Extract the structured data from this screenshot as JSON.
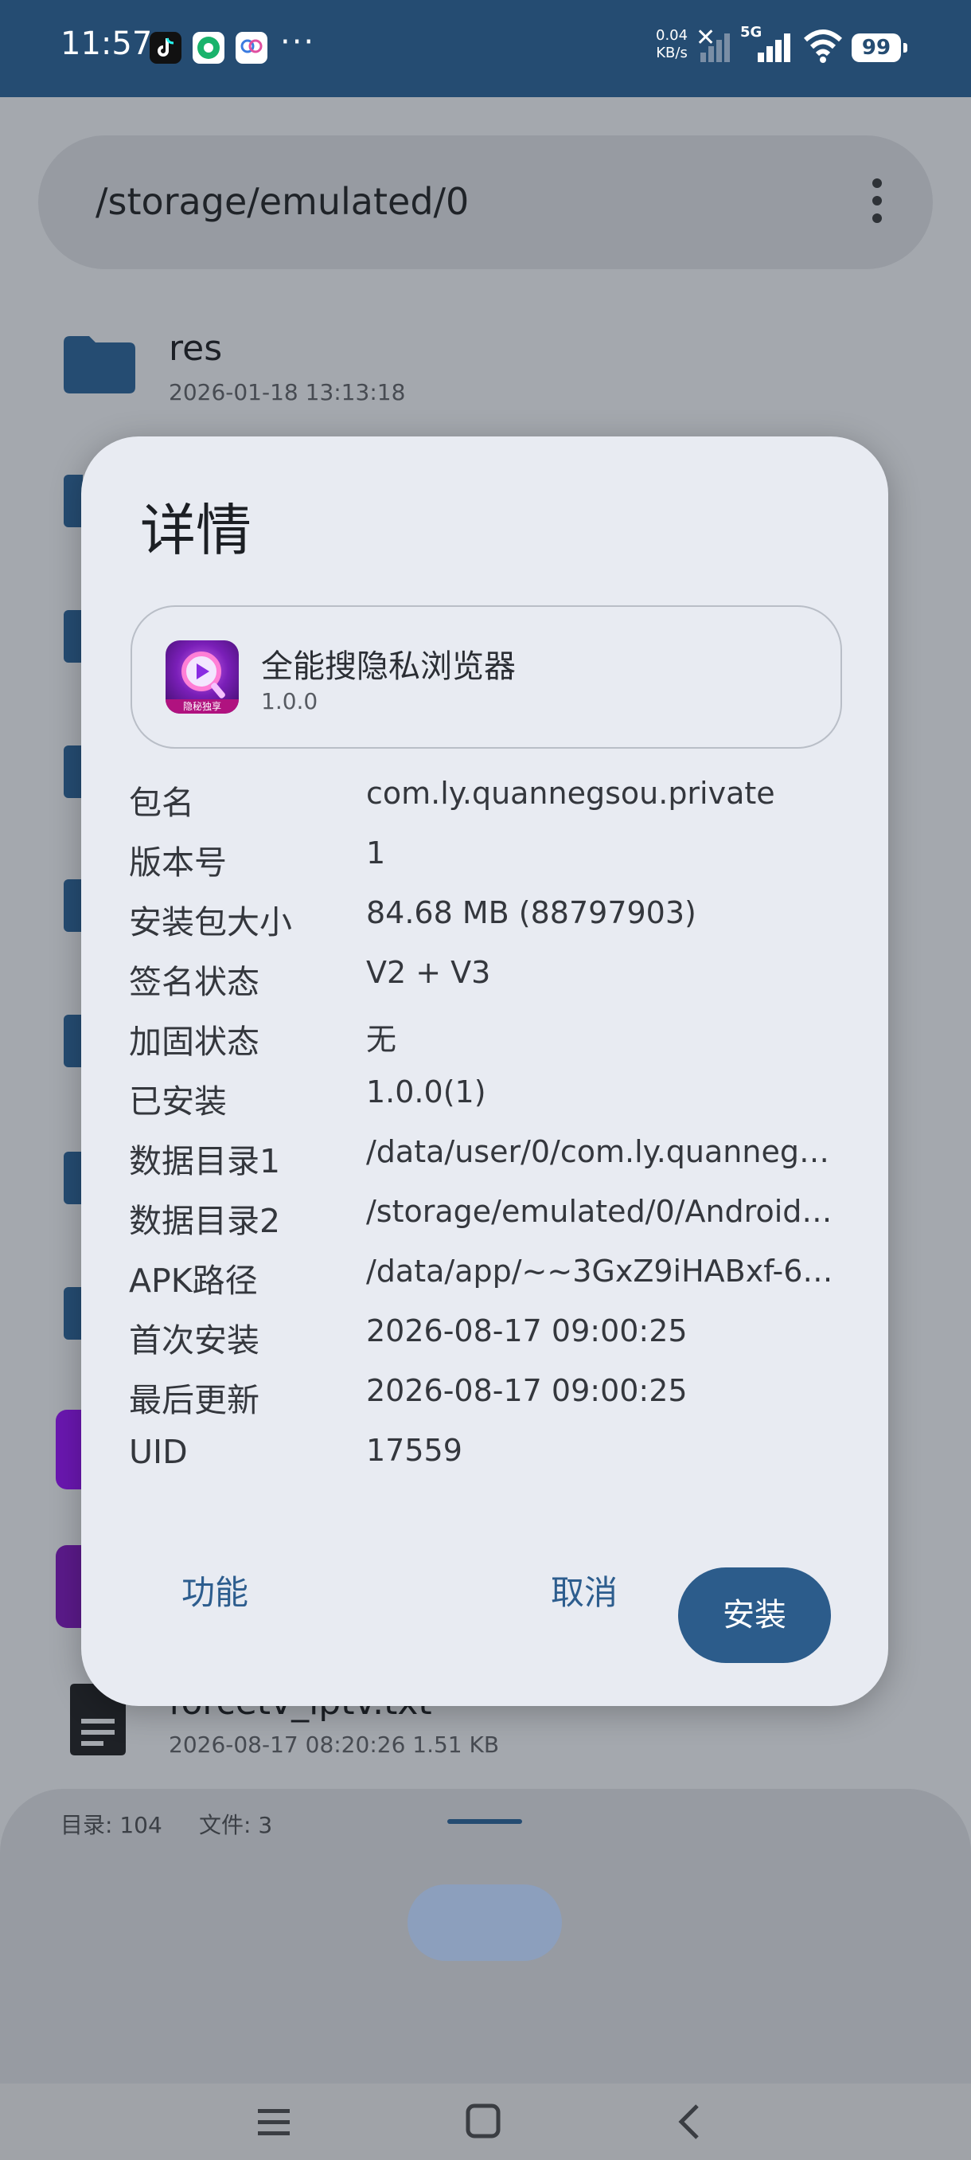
{
  "status_bar": {
    "time": "11:57",
    "net_speed_value": "0.04",
    "net_speed_unit": "KB/s",
    "network_type": "5G",
    "battery": "99",
    "overflow": "···",
    "notification_icons": [
      "tiktok-icon",
      "app-green-icon",
      "app-blue-icon"
    ]
  },
  "path_bar": {
    "path": "/storage/emulated/0"
  },
  "file_list": {
    "items": [
      {
        "name": "res",
        "meta": "2026-01-18 13:13:18",
        "icon": "folder-icon"
      },
      {
        "name": "forcetv_iptv.txt",
        "meta": "2026-08-17 08:20:26   1.51 KB",
        "icon": "text-file-icon"
      }
    ]
  },
  "footer": {
    "dir_count": "目录: 104",
    "file_count": "文件: 3"
  },
  "dialog": {
    "title": "详情",
    "app": {
      "name": "全能搜隐私浏览器",
      "version": "1.0.0",
      "icon_badge": "隐秘独享"
    },
    "rows": [
      {
        "label": "包名",
        "value": "com.ly.quannegsou.private"
      },
      {
        "label": "版本号",
        "value": "1"
      },
      {
        "label": "安装包大小",
        "value": "84.68 MB (88797903)"
      },
      {
        "label": "签名状态",
        "value": "V2 + V3"
      },
      {
        "label": "加固状态",
        "value": "无"
      },
      {
        "label": "已安装",
        "value": "1.0.0(1)"
      },
      {
        "label": "数据目录1",
        "value": "/data/user/0/com.ly.quannegs…"
      },
      {
        "label": "数据目录2",
        "value": "/storage/emulated/0/Android/…"
      },
      {
        "label": "APK路径",
        "value": "/data/app/~~3GxZ9iHABxf-6C…"
      },
      {
        "label": "首次安装",
        "value": "2026-08-17 09:00:25"
      },
      {
        "label": "最后更新",
        "value": "2026-08-17 09:00:25"
      },
      {
        "label": "UID",
        "value": "17559"
      }
    ],
    "buttons": {
      "function": "功能",
      "cancel": "取消",
      "install": "安装"
    }
  },
  "colors": {
    "status_bar": "#254c72",
    "accent": "#2c5c8b",
    "dialog_bg": "#e8ebf2",
    "scrim": "#a4a8ae"
  }
}
